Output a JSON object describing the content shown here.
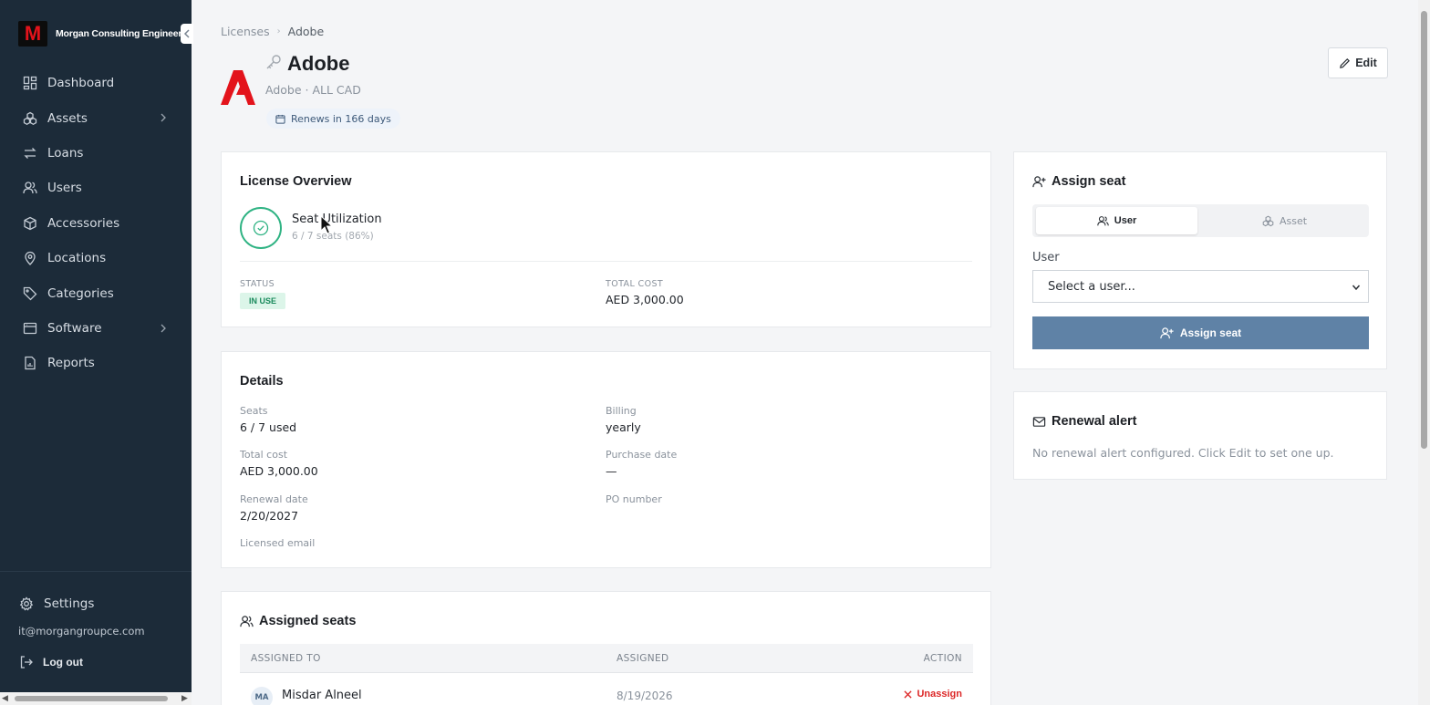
{
  "brand": {
    "logo_letter": "M",
    "name": "Morgan Consulting Engineers",
    "collapse_icon": "chevron-left-icon"
  },
  "sidebar": {
    "items": [
      {
        "label": "Dashboard",
        "icon": "dashboard-icon"
      },
      {
        "label": "Assets",
        "icon": "assets-icon",
        "has_children": true
      },
      {
        "label": "Loans",
        "icon": "loans-icon"
      },
      {
        "label": "Users",
        "icon": "users-icon"
      },
      {
        "label": "Accessories",
        "icon": "box-icon"
      },
      {
        "label": "Locations",
        "icon": "map-pin-icon"
      },
      {
        "label": "Categories",
        "icon": "tag-icon"
      },
      {
        "label": "Software",
        "icon": "window-icon",
        "has_children": true
      },
      {
        "label": "Reports",
        "icon": "report-icon"
      }
    ],
    "settings_label": "Settings",
    "user_email": "it@morgangroupce.com",
    "logout_label": "Log out"
  },
  "breadcrumb": {
    "parent": "Licenses",
    "current": "Adobe"
  },
  "header": {
    "title": "Adobe",
    "subtitle": "Adobe · ALL CAD",
    "renew_badge": "Renews in 166 days",
    "edit_label": "Edit",
    "brand_color": "#e3131b"
  },
  "overview": {
    "title": "License Overview",
    "utilization_label": "Seat Utilization",
    "utilization_sub": "6 / 7 seats (86%)",
    "utilization_fraction": 0.86,
    "status_label": "STATUS",
    "status_value": "IN USE",
    "cost_label": "TOTAL COST",
    "cost_value": "AED 3,000.00"
  },
  "details": {
    "title": "Details",
    "seats_label": "Seats",
    "seats_value": "6 / 7 used",
    "billing_label": "Billing",
    "billing_value": "yearly",
    "total_cost_label": "Total cost",
    "total_cost_value": "AED 3,000.00",
    "purchase_date_label": "Purchase date",
    "purchase_date_value": "—",
    "renewal_date_label": "Renewal date",
    "renewal_date_value": "2/20/2027",
    "po_label": "PO number",
    "licensed_email_label": "Licensed email"
  },
  "assigned_seats": {
    "title": "Assigned seats",
    "columns": [
      "ASSIGNED TO",
      "ASSIGNED",
      "ACTION"
    ],
    "rows": [
      {
        "initials": "MA",
        "name": "Misdar Alneel",
        "assigned": "8/19/2026",
        "action": "Unassign"
      }
    ]
  },
  "assign_seat": {
    "title": "Assign seat",
    "tabs": [
      "User",
      "Asset"
    ],
    "active_tab": "User",
    "field_label": "User",
    "select_placeholder": "Select a user...",
    "button_label": "Assign seat",
    "accent": "#5f82a6"
  },
  "renewal_alert": {
    "title": "Renewal alert",
    "message": "No renewal alert configured. Click Edit to set one up."
  }
}
